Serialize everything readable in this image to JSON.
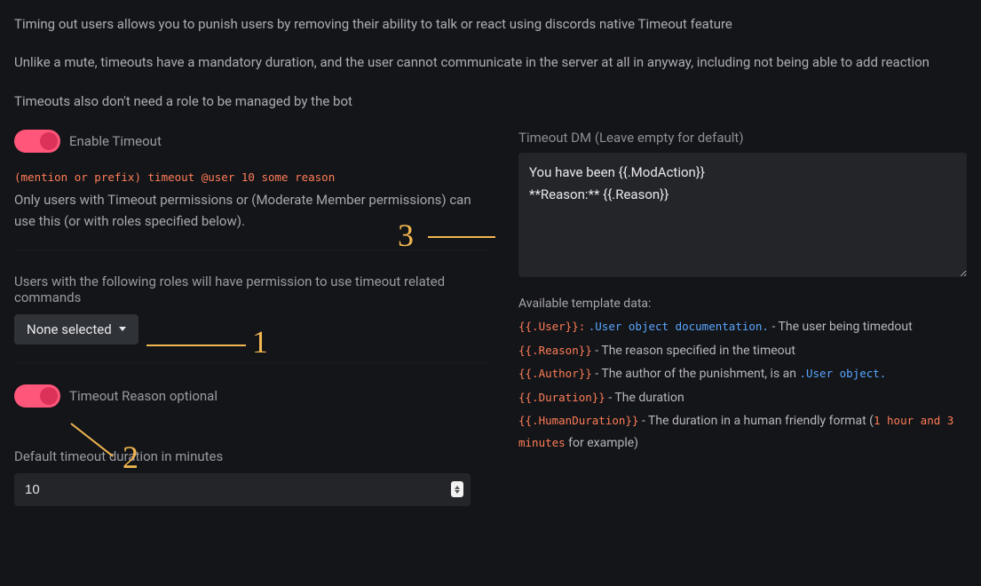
{
  "intro": {
    "p1": "Timing out users allows you to punish users by removing their ability to talk or react using discords native Timeout feature",
    "p2": "Unlike a mute, timeouts have a mandatory duration, and the user cannot communicate in the server at all in anyway, including not being able to add reaction",
    "p3": "Timeouts also don't need a role to be managed by the bot"
  },
  "left": {
    "enable_label": "Enable Timeout",
    "command_example": "(mention or prefix) timeout @user 10 some reason",
    "perm_hint": "Only users with Timeout permissions or (Moderate Member permissions) can use this (or with roles specified below).",
    "roles_label": "Users with the following roles will have permission to use timeout related commands",
    "roles_selected": "None selected",
    "reason_optional_label": "Timeout Reason optional",
    "duration_label": "Default timeout duration in minutes",
    "duration_value": "10"
  },
  "right": {
    "dm_label": "Timeout DM (Leave empty for default)",
    "dm_value": "You have been {{.ModAction}}\n**Reason:** {{.Reason}}",
    "tpl_header": "Available template data:",
    "tpl": {
      "user_key": "{{.User}}:",
      "user_link": ".User object documentation.",
      "user_desc": " - The user being timedout",
      "reason_key": "{{.Reason}}",
      "reason_desc": " - The reason specified in the timeout",
      "author_key": "{{.Author}}",
      "author_desc_a": " - The author of the punishment, is an ",
      "author_link": ".User object.",
      "duration_key": "{{.Duration}}",
      "duration_desc": " - The duration",
      "human_key": "{{.HumanDuration}}",
      "human_desc_a": " - The duration in a human friendly format (",
      "human_ex": "1 hour and 3 minutes",
      "human_desc_b": " for example)"
    }
  },
  "annotations": {
    "a1": "1",
    "a2": "2",
    "a3": "3"
  }
}
